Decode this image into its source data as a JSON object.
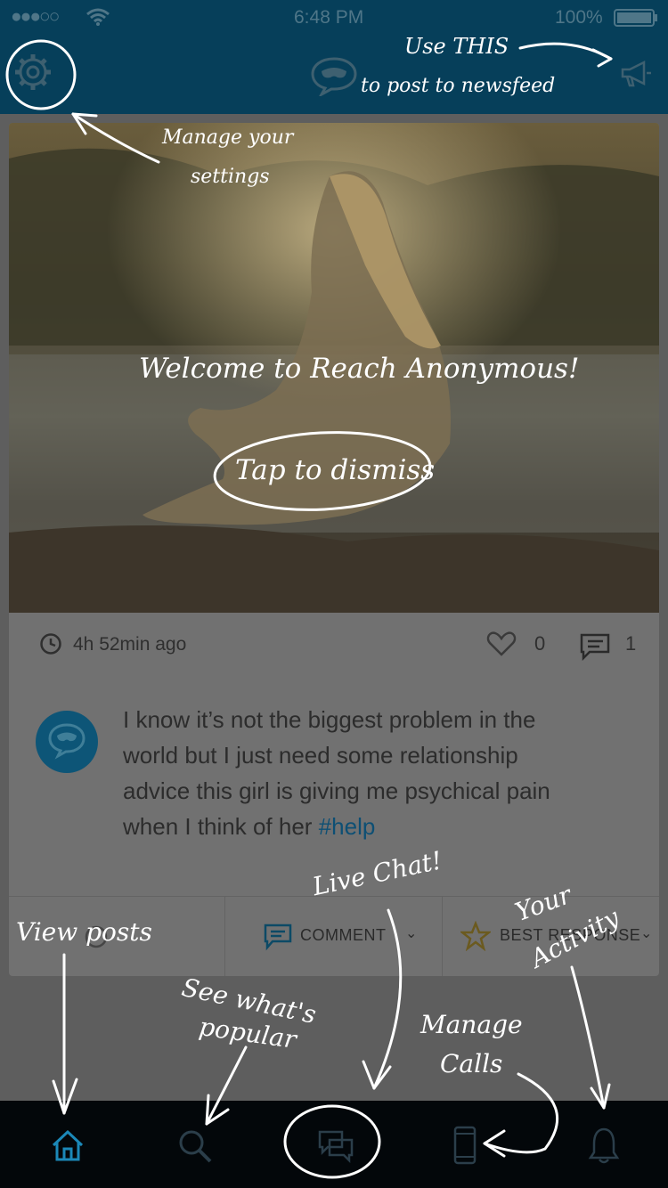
{
  "status_bar": {
    "signal": "●●●○○",
    "time": "6:48 PM",
    "battery": "100%"
  },
  "header": {
    "settings_icon": "gear-icon",
    "logo_icon": "mask-chat-logo-icon",
    "post_icon": "megaphone-icon"
  },
  "post": {
    "time_ago": "4h 52min ago",
    "likes": "0",
    "comments": "1",
    "text": "I know it’s not the biggest problem in the world but I just need some relationship advice this girl is giving me psychical pain when I think of her",
    "hashtag": "#help",
    "actions": {
      "comment": "COMMENT",
      "best_response": "BEST RESPONSE"
    }
  },
  "tabbar": {
    "items": [
      "home-icon",
      "search-icon",
      "chat-icon",
      "phone-icon",
      "bell-icon"
    ],
    "active": "home",
    "accent": "#1b88b8"
  },
  "overlay": {
    "welcome": "Welcome to Reach Anonymous!",
    "dismiss": "Tap to dismiss",
    "manage_settings_1": "Manage your",
    "manage_settings_2": "settings",
    "use_this_1": "Use THIS",
    "use_this_2": "to post to newsfeed",
    "view_posts": "View posts",
    "see_popular_1": "See what's",
    "see_popular_2": "popular",
    "live_chat": "Live Chat!",
    "manage_calls_1": "Manage",
    "manage_calls_2": "Calls",
    "your_activity_1": "Your",
    "your_activity_2": "Activity"
  }
}
